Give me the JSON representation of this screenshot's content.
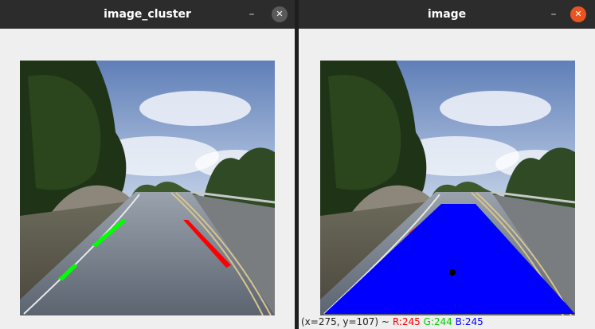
{
  "windows": {
    "left": {
      "title": "image_cluster"
    },
    "right": {
      "title": "image"
    }
  },
  "controls": {
    "minimize_glyph": "–",
    "close_glyph": "✕"
  },
  "status": {
    "coords": "(x=275, y=107) ~",
    "r": "R:245",
    "g": "G:244",
    "b": "B:245"
  },
  "colors": {
    "lane_left_cluster": "#00ff00",
    "lane_right_cluster": "#ff0000",
    "road_region": "#0000ff",
    "close_button_active": "#e95420",
    "status_r": "#ff0000",
    "status_g": "#00cc00",
    "status_b": "#0000ff"
  },
  "icons": [
    "minimize-icon",
    "close-icon"
  ]
}
